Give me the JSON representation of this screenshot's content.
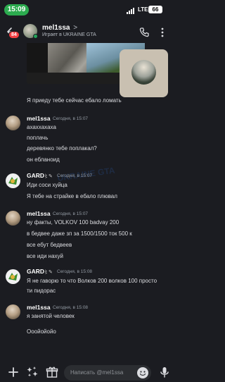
{
  "status_bar": {
    "time": "15:09",
    "network": "LTE",
    "battery": "66"
  },
  "header": {
    "unread_badge": "84",
    "name": "mel1ssa",
    "name_chevron": ">",
    "activity": "Играет в UKRAINE GTA"
  },
  "watermark": "UKRAINE GTA",
  "messages": {
    "m0": {
      "text": "Я приеду тебе сейчас ебало ломать"
    },
    "g1": {
      "author": "mel1ssa",
      "time": "Сегодня, в 15:07",
      "lines": [
        "ахаххахаха",
        "поплачь",
        "деревянко тебе поплакал?",
        "он ебланоид"
      ]
    },
    "g2": {
      "author": "GARD",
      "time": "Сегодня, в 15:07",
      "lines": [
        "Иди соси хуйца",
        "Я тебе на страйке в ебало плювал"
      ]
    },
    "g3": {
      "author": "mel1ssa",
      "time": "Сегодня, в 15:07",
      "lines": [
        "ну факты, VOLKOV 100 badvay 200",
        "в бедвее даже зп за 1500/1500 ток 500 к",
        "все ебут бедвеев",
        "все иди нахуй"
      ]
    },
    "g4": {
      "author": "GARD",
      "time": "Сегодня, в 15:08",
      "lines": [
        "Я не гаворю то что Волков 200 волков 100 просто",
        "ти пидорас"
      ]
    },
    "g5": {
      "author": "mel1ssa",
      "time": "Сегодня, в 15:08",
      "lines": [
        "я занятой человек",
        "Ооойойойо"
      ]
    }
  },
  "input": {
    "placeholder": "Написать @mel1ssa"
  },
  "icons": {
    "back": "arrow-left-icon",
    "call": "phone-icon",
    "more": "more-icon",
    "add": "plus-icon",
    "apps": "apps-icon",
    "gift": "gift-icon",
    "emoji": "emoji-icon",
    "mic": "mic-icon"
  },
  "colors": {
    "online": "#23a55a",
    "badge": "#f23f43",
    "time_pill": "#2cab4f"
  }
}
